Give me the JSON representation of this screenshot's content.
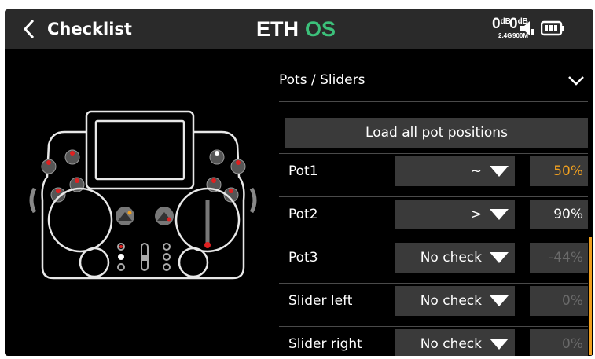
{
  "header": {
    "title": "Checklist",
    "logo_text": "ETHOS",
    "rssi": [
      {
        "value": "0",
        "unit": "dB",
        "band": "2.4G"
      },
      {
        "value": "0",
        "unit": "dB",
        "band": "900M"
      }
    ]
  },
  "section": {
    "title": "Pots / Sliders"
  },
  "load_button_label": "Load all pot positions",
  "rows": [
    {
      "label": "Pot1",
      "condition": "~",
      "value": "50%"
    },
    {
      "label": "Pot2",
      "condition": ">",
      "value": "90%"
    },
    {
      "label": "Pot3",
      "condition": "No check",
      "value": "-44%"
    },
    {
      "label": "Slider left",
      "condition": "No check",
      "value": "0%"
    },
    {
      "label": "Slider right",
      "condition": "No check",
      "value": "0%"
    }
  ],
  "colors": {
    "accent": "#f0a020",
    "logo_green": "#3cc07a",
    "control_bg": "#3a3a3a",
    "disabled_text": "#6a6a6a",
    "pot_marker": "#e02020"
  }
}
